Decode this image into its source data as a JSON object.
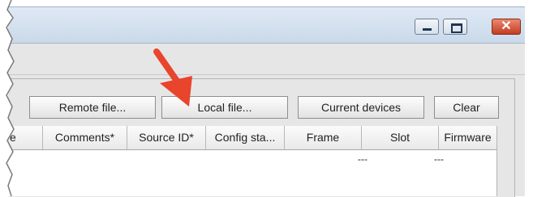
{
  "toolbar": {
    "remote_file": "Remote file...",
    "local_file": "Local file...",
    "current_devices": "Current devices",
    "clear": "Clear"
  },
  "table": {
    "columns": [
      "e",
      "Comments*",
      "Source ID*",
      "Config sta...",
      "Frame",
      "Slot",
      "Firmware"
    ],
    "rows": [
      [
        "",
        "",
        "",
        "",
        "",
        "---",
        "---"
      ]
    ]
  },
  "window": {
    "close_label": "✕"
  },
  "annotation": {
    "arrow_color": "#e8452c"
  }
}
